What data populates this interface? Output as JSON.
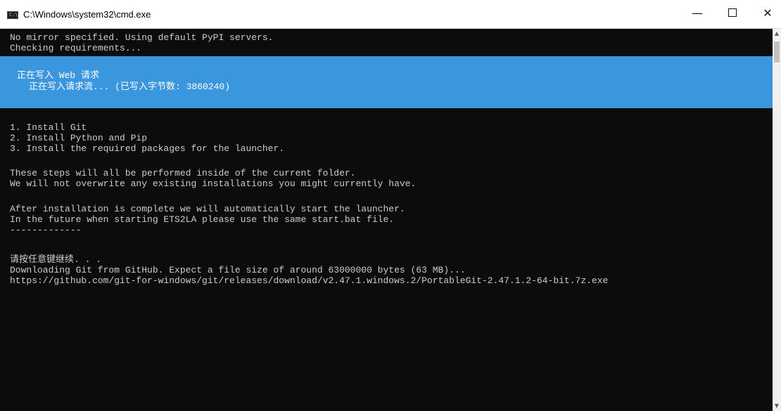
{
  "window": {
    "title": "C:\\Windows\\system32\\cmd.exe",
    "icon": "cmd-icon",
    "icon_text": "C:\\",
    "buttons": {
      "minimize": "—",
      "close": "✕"
    }
  },
  "console": {
    "lines_top": [
      "No mirror specified. Using default PyPI servers.",
      "Checking requirements..."
    ],
    "progress": {
      "activity": "正在写入 Web 请求",
      "status": "正在写入请求流... (已写入字节数: 3860240)"
    },
    "lines_steps": [
      "1. Install Git",
      "2. Install Python and Pip",
      "3. Install the required packages for the launcher."
    ],
    "lines_info": [
      "These steps will all be performed inside of the current folder.",
      "We will not overwrite any existing installations you might currently have."
    ],
    "lines_after": [
      "After installation is complete we will automatically start the launcher.",
      "In the future when starting ETS2LA please use the same start.bat file.",
      "-------------"
    ],
    "lines_download": [
      "请按任意键继续. . .",
      "Downloading Git from GitHub. Expect a file size of around 63000000 bytes (63 MB)...",
      "https://github.com/git-for-windows/git/releases/download/v2.47.1.windows.2/PortableGit-2.47.1.2-64-bit.7z.exe"
    ]
  },
  "colors": {
    "console_bg": "#0c0c0c",
    "console_fg": "#cccccc",
    "progress_bg": "#3a96dd"
  }
}
